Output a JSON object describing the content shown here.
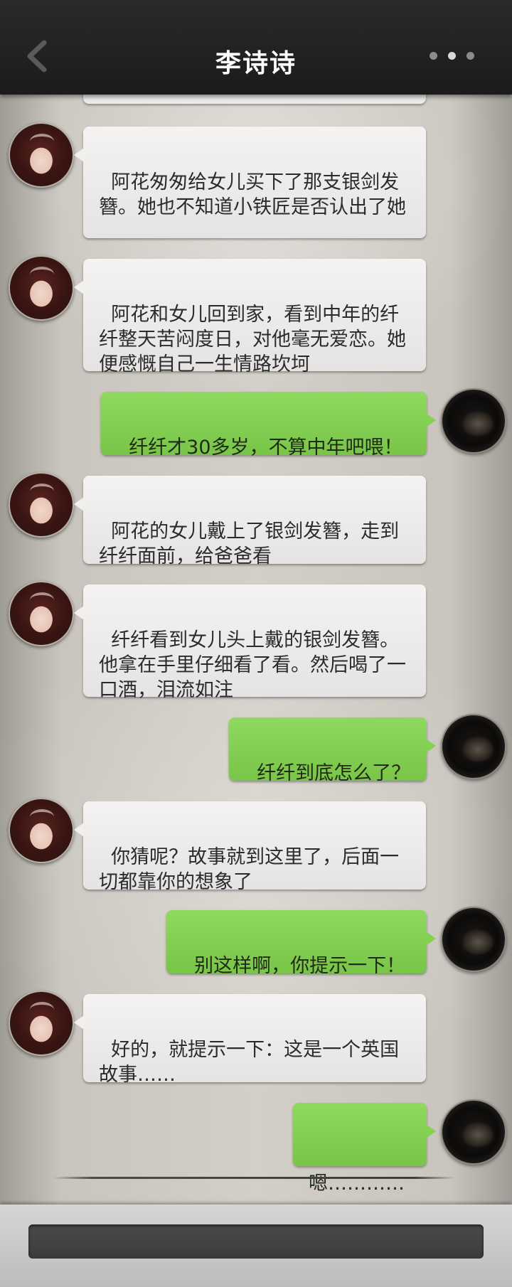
{
  "header": {
    "title": "李诗诗",
    "back_icon": "back-chevron-icon",
    "more_icon": "more-dots-icon"
  },
  "messages": [
    {
      "side": "left",
      "text": "阿花匆匆给女儿买下了那支银剑发簪。她也不知道小铁匠是否认出了她"
    },
    {
      "side": "left",
      "text": "阿花和女儿回到家，看到中年的纤纤整天苦闷度日，对他毫无爱恋。她便感慨自己一生情路坎坷"
    },
    {
      "side": "right",
      "text": "纤纤才30多岁，不算中年吧喂！"
    },
    {
      "side": "left",
      "text": "阿花的女儿戴上了银剑发簪，走到纤纤面前，给爸爸看"
    },
    {
      "side": "left",
      "text": "纤纤看到女儿头上戴的银剑发簪。他拿在手里仔细看了看。然后喝了一口酒，泪流如注"
    },
    {
      "side": "right",
      "text": "纤纤到底怎么了？"
    },
    {
      "side": "left",
      "text": "你猜呢？故事就到这里了，后面一切都靠你的想象了"
    },
    {
      "side": "right",
      "text": "别这样啊，你提示一下！"
    },
    {
      "side": "left",
      "text": "好的，就提示一下：这是一个英国故事……"
    },
    {
      "side": "right",
      "text": "嗯…………"
    }
  ],
  "colors": {
    "header_bg": "#1f1f1f",
    "left_bubble": "#ecebea",
    "right_bubble": "#85d152"
  }
}
